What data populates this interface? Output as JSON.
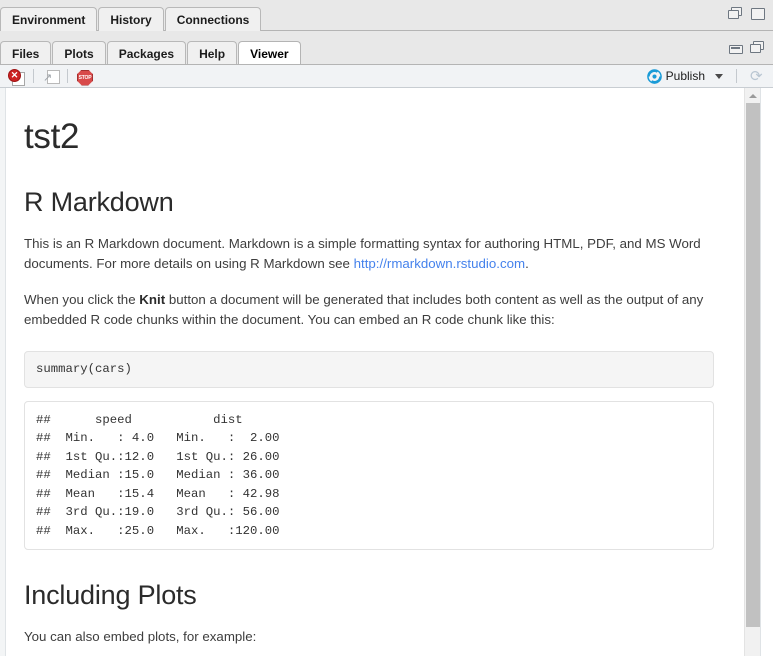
{
  "panes": {
    "top": {
      "tabs": [
        {
          "label": "Environment",
          "active": false
        },
        {
          "label": "History",
          "active": false
        },
        {
          "label": "Connections",
          "active": false
        }
      ],
      "window_controls": [
        {
          "name": "restore-icon",
          "title": "Restore"
        },
        {
          "name": "maximize-icon",
          "title": "Maximize"
        }
      ]
    },
    "bottom": {
      "tabs": [
        {
          "label": "Files",
          "active": false
        },
        {
          "label": "Plots",
          "active": false
        },
        {
          "label": "Packages",
          "active": false
        },
        {
          "label": "Help",
          "active": false
        },
        {
          "label": "Viewer",
          "active": true
        }
      ],
      "window_controls": [
        {
          "name": "minimize-icon",
          "title": "Minimize"
        },
        {
          "name": "restore-icon",
          "title": "Restore"
        }
      ]
    }
  },
  "viewer_toolbar": {
    "clear_icon": "clear-viewer-icon",
    "popout_icon": "open-in-new-window-icon",
    "stop_icon": "stop-icon",
    "stop_label": "STOP",
    "clear_glyph": "✕",
    "popout_glyph": "↗",
    "publish_label": "Publish",
    "publish_icon": "publish-icon",
    "publish_dropdown_icon": "chevron-down-icon",
    "refresh_icon": "refresh-icon",
    "refresh_glyph": "⟳"
  },
  "document": {
    "title": "tst2",
    "heading_markdown": "R Markdown",
    "paragraph1_before_link": "This is an R Markdown document. Markdown is a simple formatting syntax for authoring HTML, PDF, and MS Word documents. For more details on using R Markdown see ",
    "paragraph1_link_text": "http://rmarkdown.rstudio.com",
    "paragraph1_after_link": ".",
    "paragraph2_part1": "When you click the ",
    "paragraph2_bold": "Knit",
    "paragraph2_part2": " button a document will be generated that includes both content as well as the output of any embedded R code chunks within the document. You can embed an R code chunk like this:",
    "code_chunk": "summary(cars)",
    "code_output": "##      speed           dist\n##  Min.   : 4.0   Min.   :  2.00\n##  1st Qu.:12.0   1st Qu.: 26.00\n##  Median :15.0   Median : 36.00\n##  Mean   :15.4   Mean   : 42.98\n##  3rd Qu.:19.0   3rd Qu.: 56.00\n##  Max.   :25.0   Max.   :120.00",
    "heading_plots": "Including Plots",
    "paragraph3": "You can also embed plots, for example:"
  },
  "scrollbar": {
    "up_arrow_icon": "scroll-up-arrow-icon",
    "thumb_name": "scrollbar-thumb"
  },
  "colors": {
    "accent_link": "#4582ec",
    "publish_blue": "#1a9bd7",
    "stop_red": "#d84a4a",
    "clear_red": "#cc2222"
  }
}
